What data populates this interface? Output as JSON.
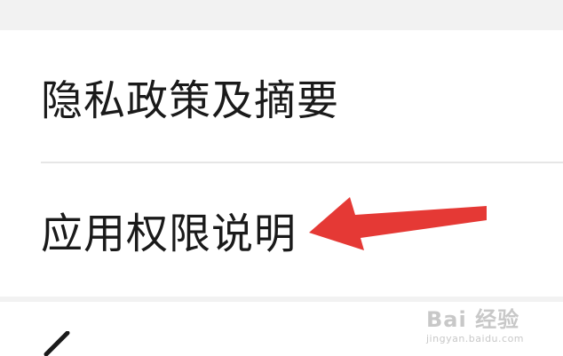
{
  "settings": {
    "items": [
      {
        "label": "隐私政策及摘要"
      },
      {
        "label": "应用权限说明"
      }
    ]
  },
  "annotation": {
    "arrow_color": "#e53935",
    "icon": "arrow-left-icon"
  },
  "watermark": {
    "logo_text": "Bai 经验",
    "url_text": "jingyan.baidu.com"
  },
  "colors": {
    "text": "#1a1a1a",
    "divider": "#e6e6e6",
    "gap": "#f2f2f2"
  }
}
